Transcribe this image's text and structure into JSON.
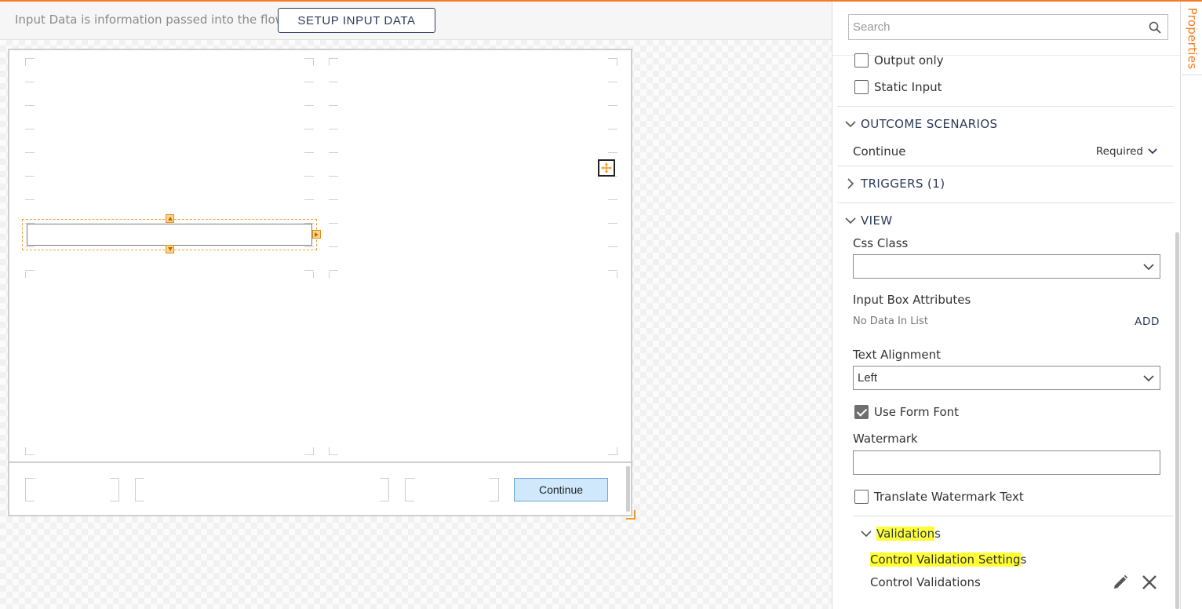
{
  "banner": {
    "text": "Input Data is information passed into the flow",
    "setup_button": "SETUP INPUT DATA"
  },
  "form": {
    "continue_button": "Continue"
  },
  "properties": {
    "tab_label": "Properties",
    "search_placeholder": "Search",
    "output_only": {
      "label": "Output only",
      "checked": false
    },
    "static_input": {
      "label": "Static Input",
      "checked": false
    },
    "outcome_scenarios": {
      "title": "OUTCOME SCENARIOS",
      "expanded": true,
      "row_label": "Continue",
      "row_status": "Required"
    },
    "triggers": {
      "title": "TRIGGERS (1)",
      "expanded": false
    },
    "view": {
      "title": "VIEW",
      "expanded": true,
      "css_class_label": "Css Class",
      "css_class_value": "",
      "input_box_attributes_label": "Input Box Attributes",
      "no_data_text": "No Data In List",
      "add_label": "ADD",
      "text_alignment_label": "Text Alignment",
      "text_alignment_value": "Left",
      "use_form_font": {
        "label": "Use Form Font",
        "checked": true
      },
      "watermark_label": "Watermark",
      "watermark_value": "",
      "translate_watermark": {
        "label": "Translate Watermark Text",
        "checked": false
      }
    },
    "validations": {
      "title_highlighted": "Validation",
      "title_rest": "s",
      "settings_highlighted": "Control Validation Setting",
      "settings_rest": "s",
      "control_validations": "Control Validations"
    }
  },
  "colors": {
    "accent_orange": "#f47b20",
    "navy": "#2c3a57",
    "highlight_yellow": "#ffff33",
    "continue_button_bg": "#cfe8fb"
  }
}
